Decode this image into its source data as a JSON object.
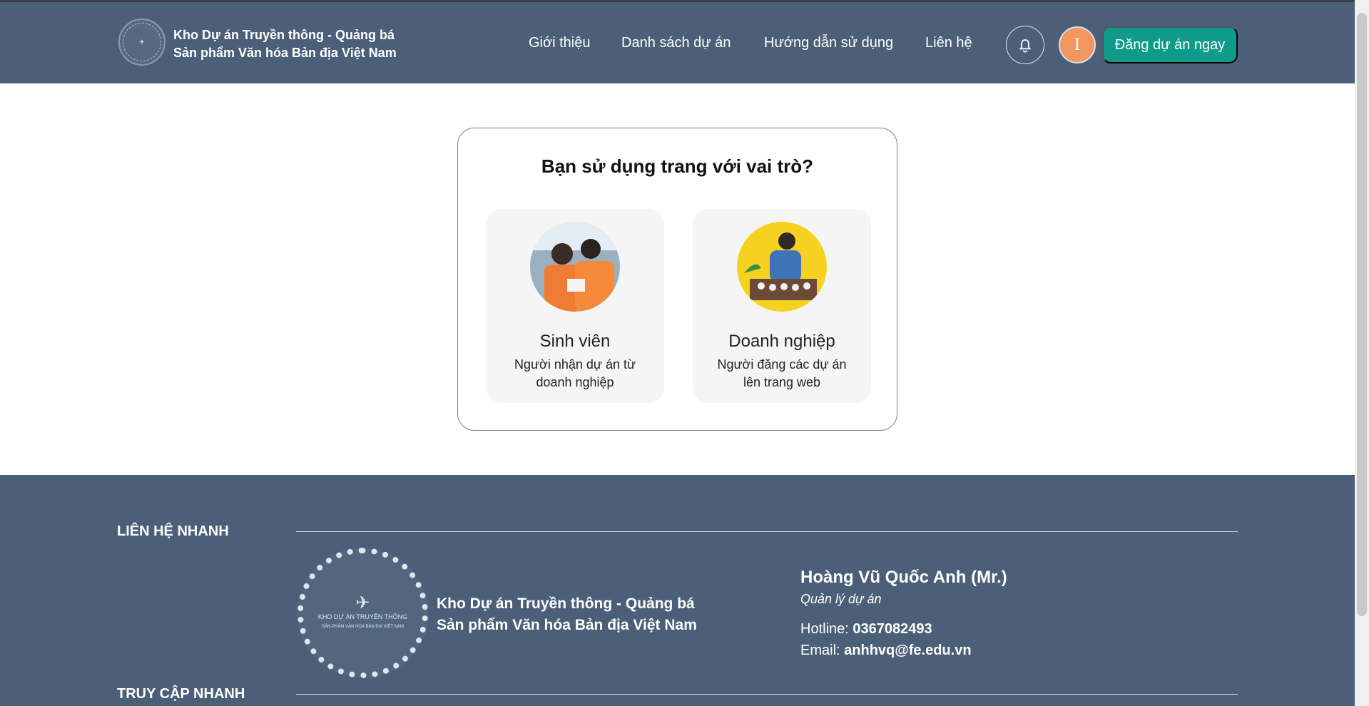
{
  "brand": {
    "title_line1": "Kho Dự án Truyền thông - Quảng bá",
    "title_line2": "Sản phẩm Văn hóa Bản địa Việt Nam"
  },
  "nav": {
    "items": [
      "Giới thiệu",
      "Danh sách dự án",
      "Hướng dẫn sử dụng",
      "Liên hệ"
    ],
    "avatar_initial": "I",
    "cta": "Đăng dự án ngay"
  },
  "role_picker": {
    "title": "Bạn sử dụng trang với vai trò?",
    "roles": [
      {
        "name": "Sinh viên",
        "desc": "Người nhận dự án từ doanh nghiệp"
      },
      {
        "name": "Doanh nghiệp",
        "desc": "Người đăng các dự án lên trang web"
      }
    ]
  },
  "footer": {
    "quick_contact": "LIÊN HỆ NHANH",
    "quick_access": "TRUY CẬP NHANH",
    "logo_text1": "KHO DỰ ÁN TRUYỀN THÔNG",
    "logo_text2": "SẢN PHẨM VĂN HÓA BẢN ĐỊA VIỆT NAM",
    "brand_line1": "Kho Dự án Truyền thông - Quảng bá",
    "brand_line2": "Sản phẩm Văn hóa Bản địa Việt Nam",
    "contact_name": "Hoàng Vũ Quốc Anh (Mr.)",
    "contact_role": "Quản lý dự án",
    "hotline_label": "Hotline:",
    "hotline_value": "0367082493",
    "email_label": "Email:",
    "email_value": "anhhvq@fe.edu.vn"
  },
  "colors": {
    "header": "#4b6078",
    "cta": "#0f9a8a",
    "avatar": "#f2965e"
  }
}
